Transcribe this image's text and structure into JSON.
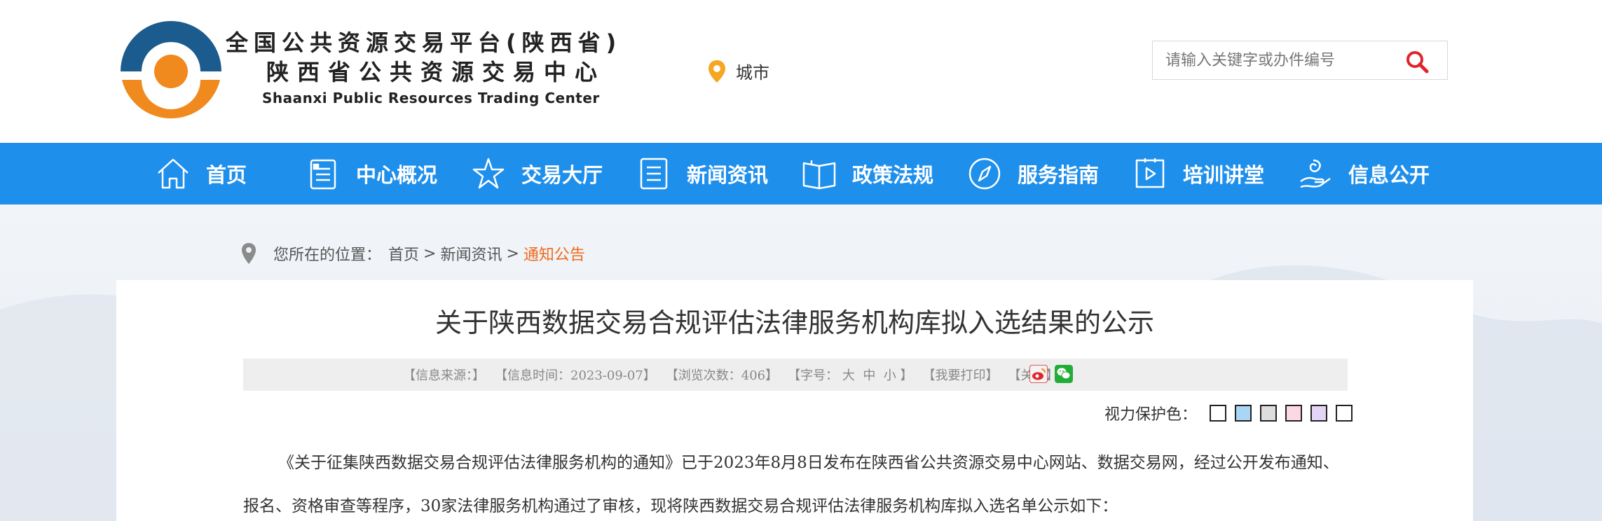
{
  "logo": {
    "cn_line1": "全国公共资源交易平台(陕西省)",
    "cn_line2": "陕西省公共资源交易中心",
    "en_line": "Shaanxi Public Resources Trading Center"
  },
  "city": {
    "label": "城市",
    "icon": "location-pin-icon"
  },
  "search": {
    "placeholder": "请输入关键字或办件编号",
    "icon": "search-icon"
  },
  "nav": {
    "items": [
      {
        "label": "首页",
        "icon": "home-icon"
      },
      {
        "label": "中心概况",
        "icon": "document-icon"
      },
      {
        "label": "交易大厅",
        "icon": "star-icon"
      },
      {
        "label": "新闻资讯",
        "icon": "news-icon"
      },
      {
        "label": "政策法规",
        "icon": "book-icon"
      },
      {
        "label": "服务指南",
        "icon": "compass-icon"
      },
      {
        "label": "培训讲堂",
        "icon": "video-icon"
      },
      {
        "label": "信息公开",
        "icon": "hand-icon"
      }
    ]
  },
  "breadcrumb": {
    "prefix": "您所在的位置：",
    "items": [
      "首页",
      "新闻资讯",
      "通知公告"
    ],
    "separator": ">"
  },
  "article": {
    "title": "关于陕西数据交易合规评估法律服务机构库拟入选结果的公示",
    "info": {
      "source": "【信息来源：】",
      "time": "【信息时间：2023-09-07】",
      "views": "【浏览次数：406】",
      "font_prefix": "【字号：",
      "font_large": "大",
      "font_medium": "中",
      "font_small": "小",
      "font_suffix": "】",
      "print": "【我要打印】",
      "close": "【关闭】"
    },
    "share_icons": [
      "weibo-icon",
      "wechat-icon"
    ],
    "vision_label": "视力保护色：",
    "vision_colors": [
      "#ffffff",
      "#a9d6f5",
      "#dddddd",
      "#fcd8e4",
      "#e4d4f6",
      "#ffffff"
    ],
    "body": "《关于征集陕西数据交易合规评估法律服务机构的通知》已于2023年8月8日发布在陕西省公共资源交易中心网站、数据交易网，经过公开发布通知、报名、资格审查等程序，30家法律服务机构通过了审核，现将陕西数据交易合规评估法律服务机构库拟入选名单公示如下："
  },
  "colors": {
    "nav_bg": "#1f8fec",
    "accent_orange": "#f06a1a",
    "logo_blue": "#1b5b8e",
    "logo_orange": "#f08a1e"
  }
}
